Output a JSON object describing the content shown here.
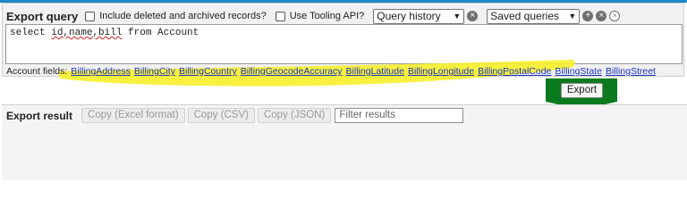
{
  "query": {
    "title": "Export query",
    "include_deleted_label": "Include deleted and archived records?",
    "tooling_label": "Use Tooling API?",
    "history_select": "Query history",
    "saved_select": "Saved queries",
    "query_prefix": "select ",
    "query_fields": "id,name,bill",
    "query_suffix": " from Account",
    "fields_label": "Account fields:",
    "fields": [
      "BillingAddress",
      "BillingCity",
      "BillingCountry",
      "BillingGeocodeAccuracy",
      "BillingLatitude",
      "BillingLongitude",
      "BillingPostalCode",
      "BillingState",
      "BillingStreet"
    ]
  },
  "export_label": "Export",
  "result": {
    "title": "Export result",
    "copy_excel": "Copy (Excel format)",
    "copy_csv": "Copy (CSV)",
    "copy_json": "Copy (JSON)",
    "filter_placeholder": "Filter results"
  },
  "colors": {
    "highlight": "#f7ef2b",
    "arrow": "#0b7a1f",
    "accent_line": "#1e88c7"
  }
}
